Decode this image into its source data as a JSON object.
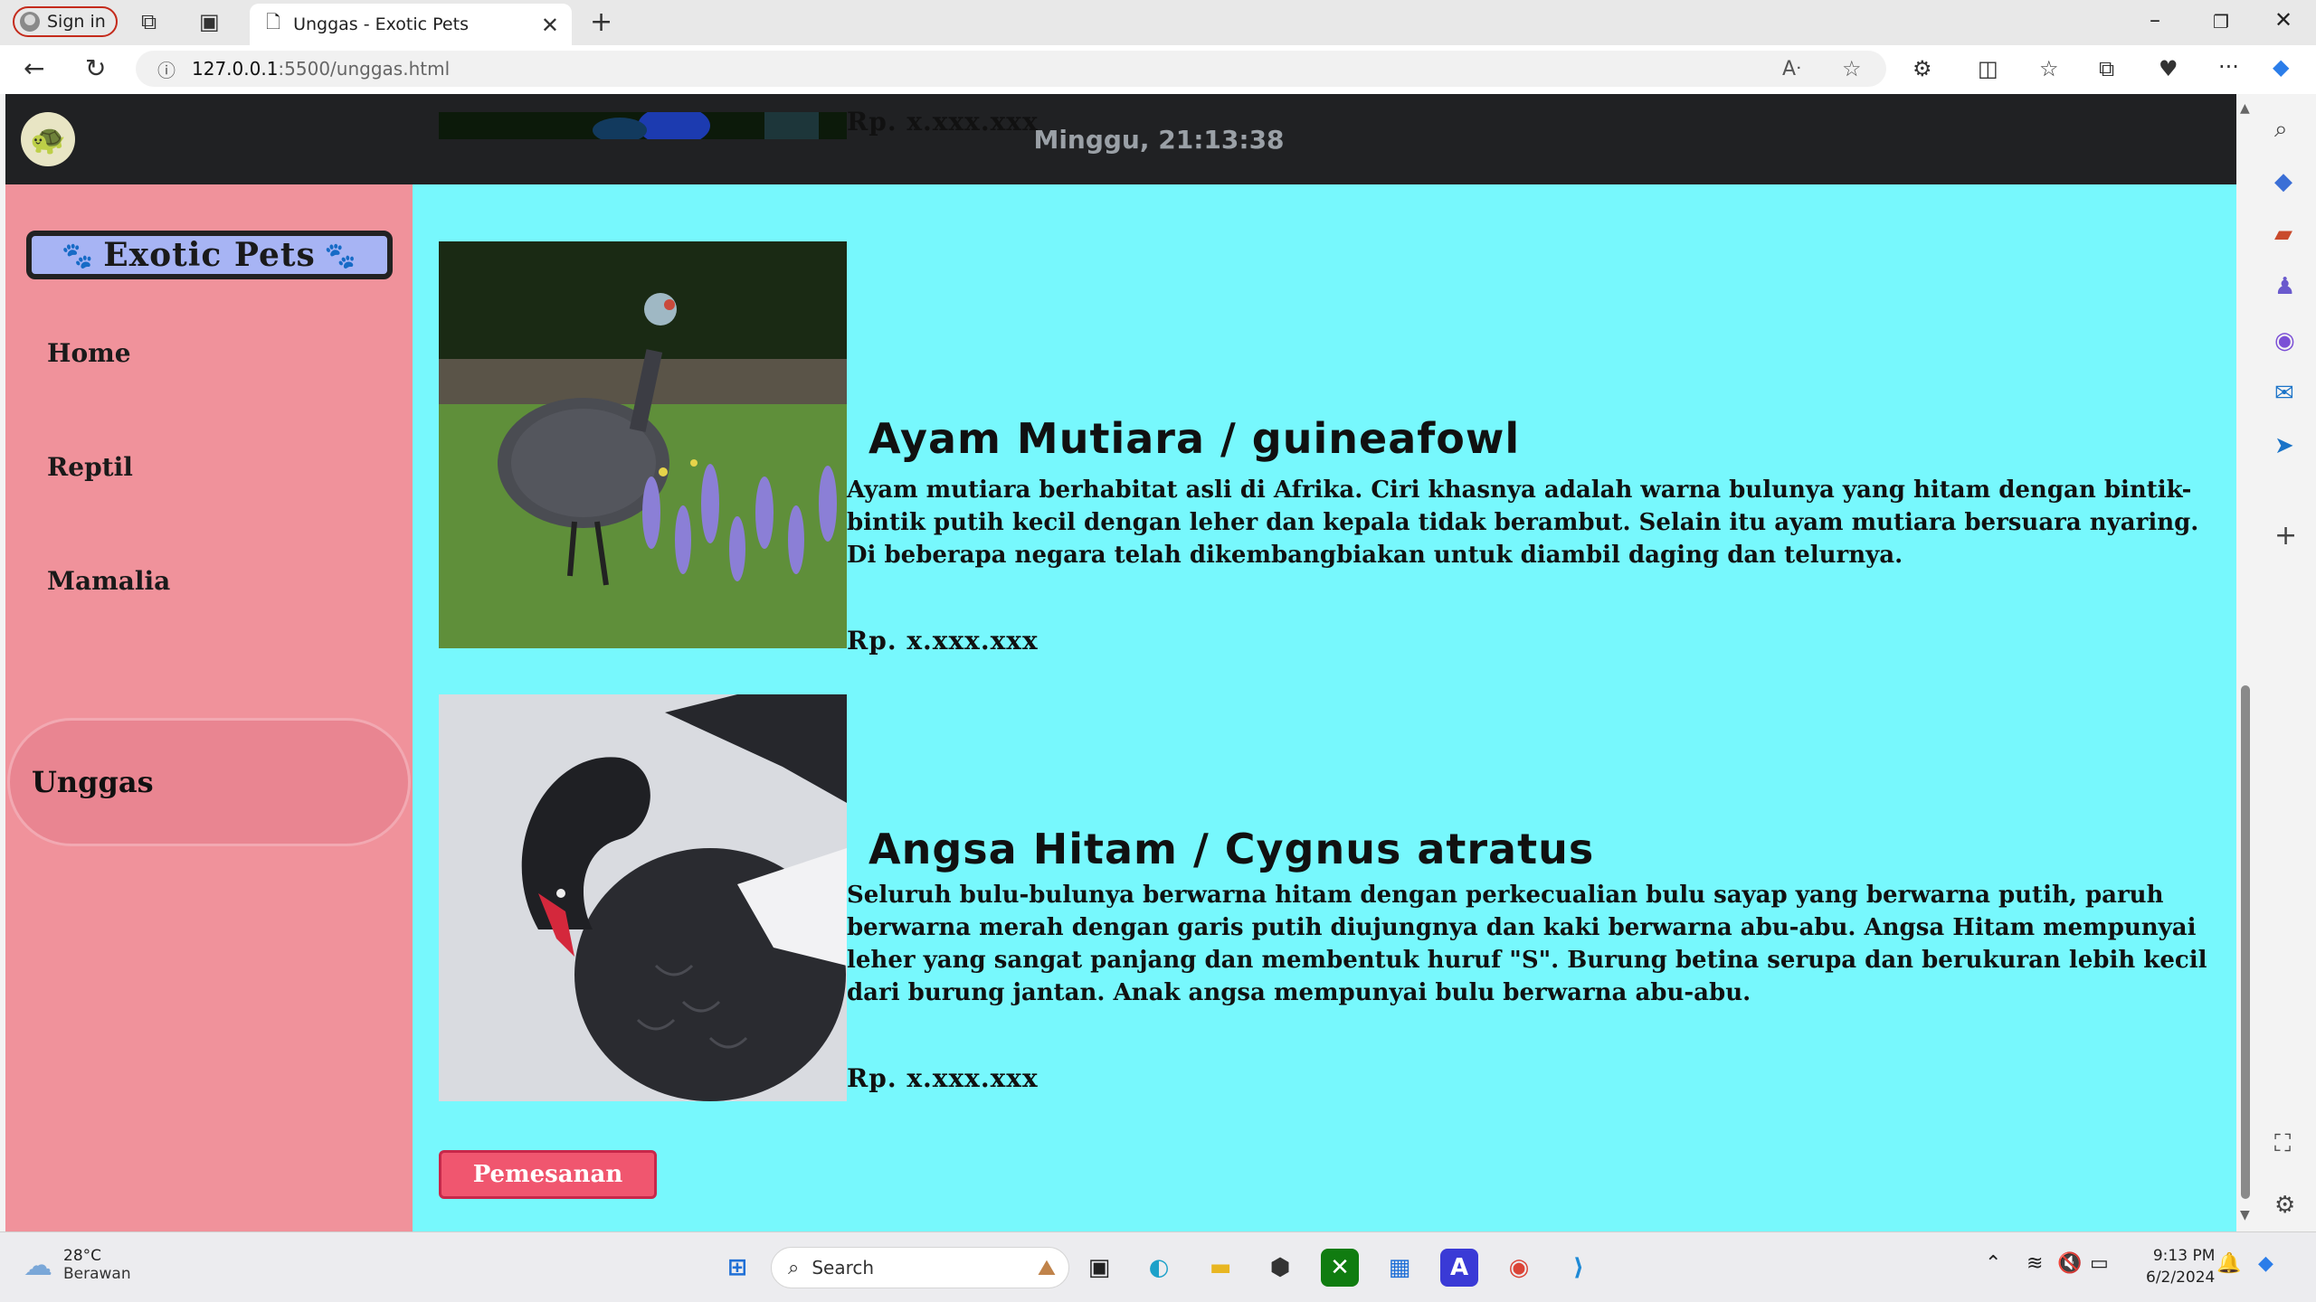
{
  "browser": {
    "signin_label": "Sign in",
    "tab_title": "Unggas - Exotic Pets",
    "url_host": "127.0.0.1",
    "url_path": ":5500/unggas.html"
  },
  "page": {
    "clock": "Minggu, 21:13:38",
    "brand": "Exotic Pets",
    "nav": [
      {
        "label": "Home"
      },
      {
        "label": "Reptil"
      },
      {
        "label": "Mamalia"
      },
      {
        "label": "Unggas",
        "active": true
      }
    ],
    "products": [
      {
        "price": "Rp. x.xxx.xxx"
      },
      {
        "title": "Ayam Mutiara / guineafowl",
        "description": "Ayam mutiara berhabitat asli di Afrika. Ciri khasnya adalah warna bulunya yang hitam dengan bintik-bintik putih kecil dengan leher dan kepala tidak berambut. Selain itu ayam mutiara bersuara nyaring. Di beberapa negara telah dikembangbiakan untuk diambil daging dan telurnya.",
        "price": "Rp. x.xxx.xxx"
      },
      {
        "title": "Angsa Hitam / Cygnus atratus",
        "description": "Seluruh bulu-bulunya berwarna hitam dengan perkecualian bulu sayap yang berwarna putih, paruh berwarna merah dengan garis putih diujungnya dan kaki berwarna abu-abu. Angsa Hitam mempunyai leher yang sangat panjang dan membentuk huruf \"S\". Burung betina serupa dan berukuran lebih kecil dari burung jantan. Anak angsa mempunyai bulu berwarna abu-abu.",
        "price": "Rp. x.xxx.xxx"
      }
    ],
    "order_button": "Pemesanan"
  },
  "taskbar": {
    "temperature": "28°C",
    "weather": "Berawan",
    "search_placeholder": "Search",
    "time": "9:13 PM",
    "date": "6/2/2024"
  },
  "colors": {
    "page_bg": "#77f8fd",
    "sidebar_bg": "#f0929b",
    "header_bg": "#202123",
    "button_bg": "#f0566f"
  }
}
